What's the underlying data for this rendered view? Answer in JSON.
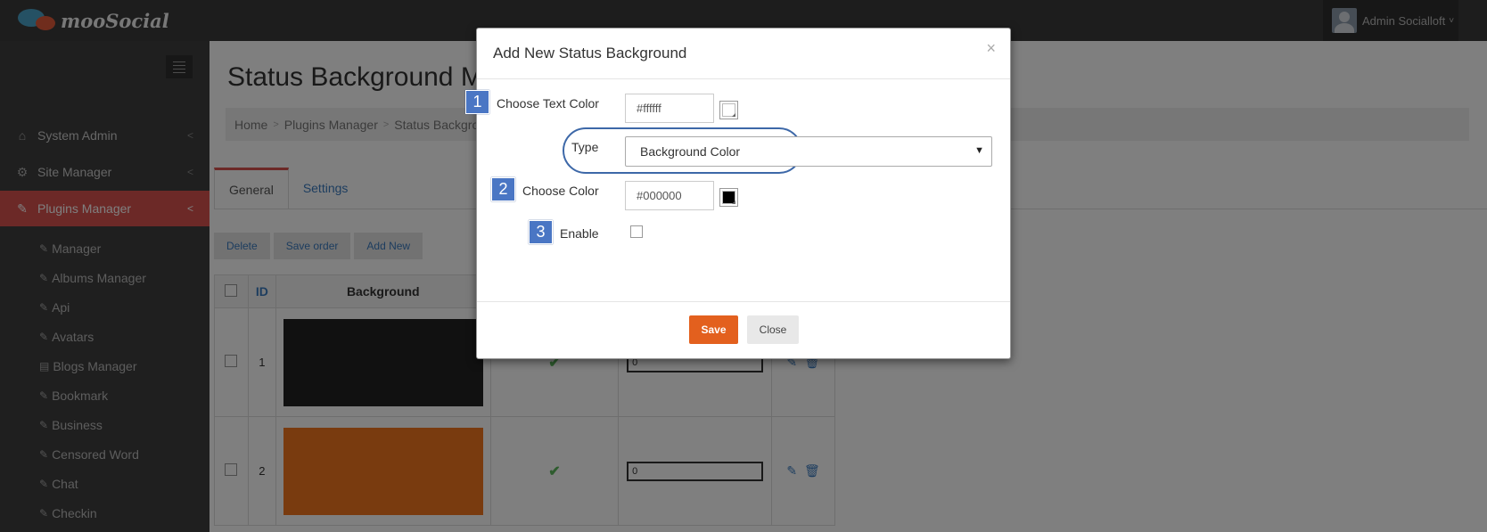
{
  "header": {
    "logo_text": "mooSocial",
    "user_name": "Admin Socialloft",
    "user_caret": "˅"
  },
  "sidebar": {
    "main_items": [
      {
        "label": "System Admin",
        "icon": "home-icon"
      },
      {
        "label": "Site Manager",
        "icon": "gears-icon"
      },
      {
        "label": "Plugins Manager",
        "icon": "plug-icon"
      }
    ],
    "sub_items": [
      "Manager",
      "Albums Manager",
      "Api",
      "Avatars",
      "Blogs Manager",
      "Bookmark",
      "Business",
      "Censored Word",
      "Chat",
      "Checkin"
    ],
    "chevron": "<"
  },
  "page": {
    "title": "Status Background Manager",
    "breadcrumb": [
      "Home",
      "Plugins Manager",
      "Status Background"
    ],
    "breadcrumb_sep": ">",
    "tabs": [
      "General",
      "Settings"
    ],
    "toolbar": {
      "delete": "Delete",
      "save_order": "Save order",
      "add_new": "Add New"
    },
    "table": {
      "headers": {
        "id": "ID",
        "background": "Background"
      },
      "rows": [
        {
          "id": "1",
          "color": "#222222",
          "order": "0"
        },
        {
          "id": "2",
          "color": "#f2771f",
          "order": "0"
        }
      ]
    }
  },
  "modal": {
    "title": "Add New Status Background",
    "close_glyph": "×",
    "text_color_label": "Choose Text Color",
    "text_color_value": "#ffffff",
    "type_label": "Type",
    "type_value": "Background Color",
    "color_label": "Choose Color",
    "color_value": "#000000",
    "enable_label": "Enable",
    "steps": [
      "1",
      "2",
      "3"
    ],
    "save_label": "Save",
    "close_label": "Close"
  },
  "colors": {
    "accent_red": "#d9534f",
    "save_orange": "#e3601e",
    "badge_blue": "#4a76c4",
    "link_blue": "#3a7abf"
  }
}
